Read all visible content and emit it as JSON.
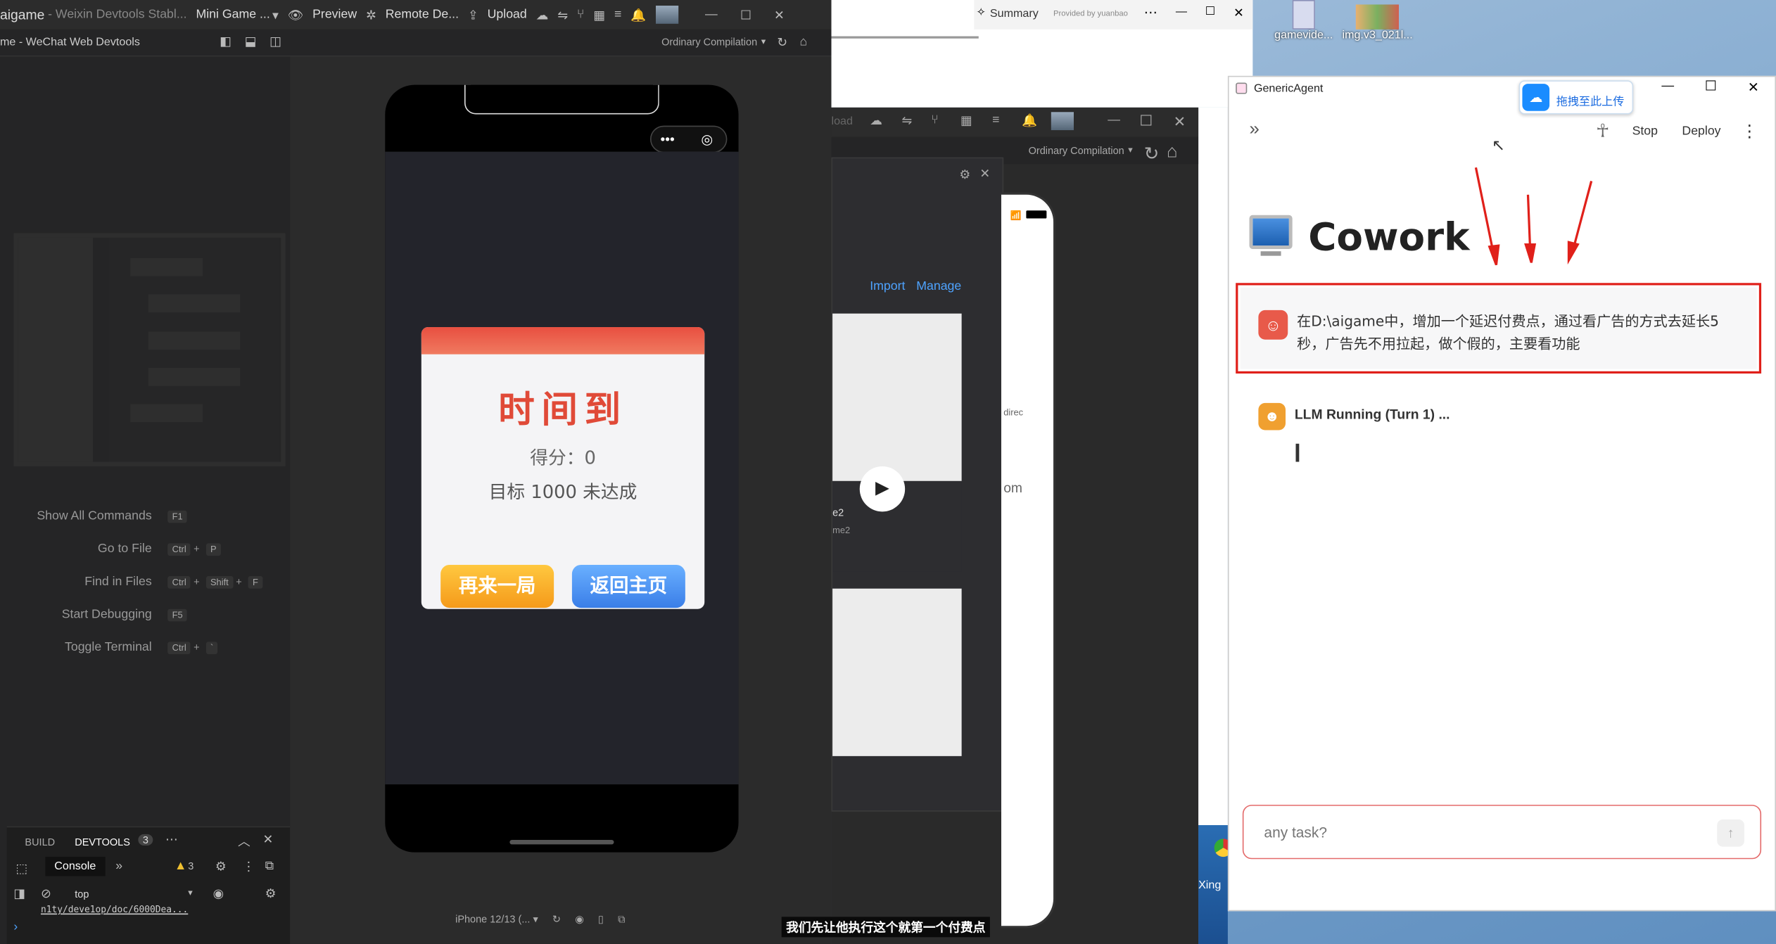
{
  "devtools": {
    "title_app": "aigame",
    "title_sep": "-",
    "title_rest": "Weixin Devtools Stabl...",
    "mode": "Mini Game ...",
    "toolbar": {
      "preview": "Preview",
      "remote": "Remote De...",
      "upload": "Upload"
    },
    "subtitle": "me - WeChat Web Devtools",
    "compilation": "Ordinary Compilation",
    "commands": [
      {
        "label": "Show All Commands",
        "keys": [
          "F1"
        ]
      },
      {
        "label": "Go to File",
        "keys": [
          "Ctrl",
          "+",
          "P"
        ]
      },
      {
        "label": "Find in Files",
        "keys": [
          "Ctrl",
          "+",
          "Shift",
          "+",
          "F"
        ]
      },
      {
        "label": "Start Debugging",
        "keys": [
          "F5"
        ]
      },
      {
        "label": "Toggle Terminal",
        "keys": [
          "Ctrl",
          "+",
          "`"
        ]
      }
    ],
    "panel": {
      "build": "BUILD",
      "devtools": "DEVTOOLS",
      "devtools_count": "3",
      "console": "Console",
      "warn_count": "3",
      "context": "top",
      "log_line": "n1ty/deve1op/doc/6000Dea..."
    },
    "device": "iPhone 12/13 (..."
  },
  "game": {
    "title": "时间到",
    "score": "得分：0",
    "target": "目标 1000 未达成",
    "btn_retry": "再来一局",
    "btn_home": "返回主页"
  },
  "middle": {
    "summary": "Summary",
    "provided": "Provided by yuanbao",
    "compilation": "Ordinary Compilation",
    "import": "Import",
    "manage": "Manage",
    "loaded": "load",
    "frag1": "direc",
    "frag2": "om",
    "frag3": "e2",
    "frag4": "me2"
  },
  "subtitle_caption": "我们先让他执行这个就第一个付费点",
  "desktop": {
    "icon1": "gamevide...",
    "icon2": "img.v3_021l..."
  },
  "xing": "Xing",
  "agent": {
    "title": "GenericAgent",
    "upload_badge": "拖拽至此上传",
    "stop": "Stop",
    "deploy": "Deploy",
    "heading": "Cowork",
    "user_message": "在D:\\aigame中，增加一个延迟付费点，通过看广告的方式去延长5秒，广告先不用拉起，做个假的，主要看功能",
    "status": "LLM Running (Turn 1) ...",
    "input_placeholder": "any task?"
  },
  "colors": {
    "accent_red": "#e0201a",
    "link_blue": "#4ea3ff",
    "agent_icon": "#e85a4a",
    "running_icon": "#f0a030"
  }
}
